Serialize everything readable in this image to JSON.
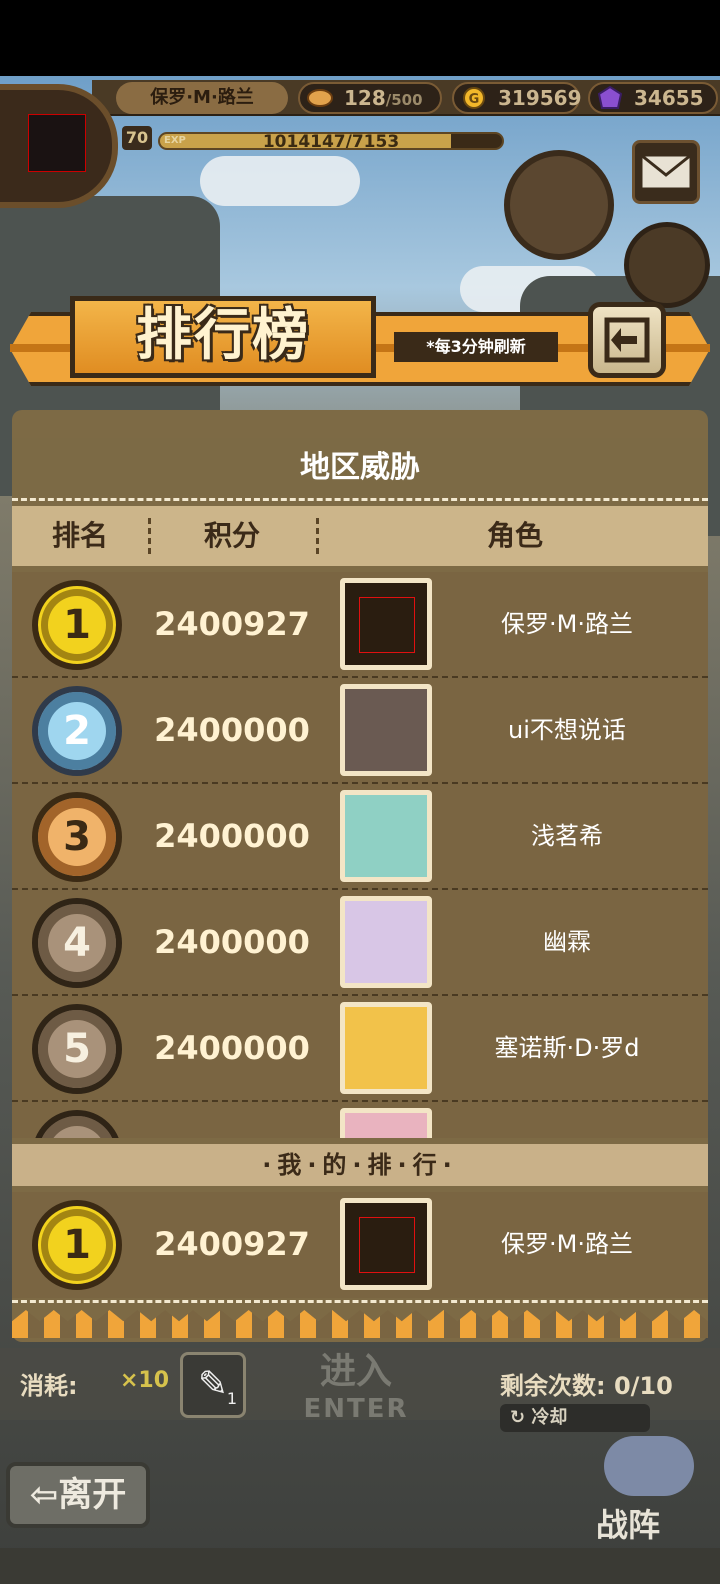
{
  "hud": {
    "player_name": "保罗·M·路兰",
    "stamina": "128",
    "stamina_max": "/500",
    "gold": "319569",
    "gems": "34655",
    "level": "70",
    "exp_label": "EXP",
    "exp_text": "1014147/7153",
    "exp_fraction": 0.85
  },
  "banner": {
    "title": "排行榜",
    "refresh_note": "*每3分钟刷新",
    "back_icon": "return-arrow-icon"
  },
  "panel": {
    "title": "地区威胁",
    "columns": [
      "排名",
      "积分",
      "角色"
    ]
  },
  "rankings": [
    {
      "rank": "1",
      "medal": "gold",
      "score": "2400927",
      "name": "保罗·M·路兰",
      "portrait": "missing"
    },
    {
      "rank": "2",
      "medal": "silver",
      "score": "2400000",
      "name": "ui不想说话",
      "portrait": "#6a5a52"
    },
    {
      "rank": "3",
      "medal": "bronze",
      "score": "2400000",
      "name": "浅茗希",
      "portrait": "#8fd0c4"
    },
    {
      "rank": "4",
      "medal": "plain",
      "score": "2400000",
      "name": "幽霖",
      "portrait": "#d8c6e6"
    },
    {
      "rank": "5",
      "medal": "plain",
      "score": "2400000",
      "name": "塞诺斯·D·罗d",
      "portrait": "#f2c24a"
    }
  ],
  "my_rank_label": "·我·的·排·行·",
  "my_rank": {
    "rank": "1",
    "medal": "gold",
    "score": "2400927",
    "name": "保罗·M·路兰"
  },
  "bottom": {
    "consume_label": "消耗:",
    "consume_count": "×10",
    "item_count": "1",
    "enter_cn": "进入",
    "enter_en": "ENTER",
    "remaining": "剩余次数: 0/10",
    "cooldown": "冷却",
    "leave": "离开",
    "formation": "战阵"
  }
}
